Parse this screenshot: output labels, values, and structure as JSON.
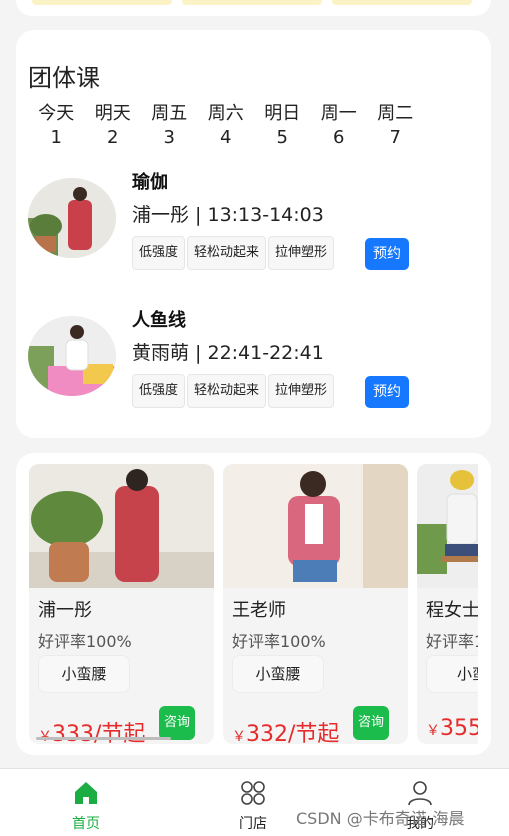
{
  "group_classes": {
    "title": "团体课",
    "days": [
      {
        "label": "今天",
        "num": "1"
      },
      {
        "label": "明天",
        "num": "2"
      },
      {
        "label": "周五",
        "num": "3"
      },
      {
        "label": "周六",
        "num": "4"
      },
      {
        "label": "明日",
        "num": "5"
      },
      {
        "label": "周一",
        "num": "6"
      },
      {
        "label": "周二",
        "num": "7"
      }
    ],
    "classes": [
      {
        "name": "瑜伽",
        "info": "浦一彤 | 13:13-14:03",
        "tags": [
          "低强度",
          "轻松动起来",
          "拉伸塑形"
        ],
        "button": "预约"
      },
      {
        "name": "人鱼线",
        "info": "黄雨萌 | 22:41-22:41",
        "tags": [
          "低强度",
          "轻松动起来",
          "拉伸塑形"
        ],
        "button": "预约"
      }
    ]
  },
  "coaches": [
    {
      "name": "浦一彤",
      "rating": "好评率100%",
      "tag": "小蛮腰",
      "currency": "￥",
      "price": "333/节起",
      "button": "咨询"
    },
    {
      "name": "王老师",
      "rating": "好评率100%",
      "tag": "小蛮腰",
      "currency": "￥",
      "price": "332/节起",
      "button": "咨询"
    },
    {
      "name": "程女士",
      "rating": "好评率1",
      "tag": "小蛮",
      "currency": "￥",
      "price": "355",
      "button": ""
    }
  ],
  "bottom_nav": [
    {
      "label": "首页",
      "icon": "home-icon",
      "active": true
    },
    {
      "label": "门店",
      "icon": "grid-icon",
      "active": false
    },
    {
      "label": "我的",
      "icon": "user-icon",
      "active": false
    }
  ],
  "watermark": "CSDN @卡布奇诺-海晨",
  "colors": {
    "accent_blue": "#1677ff",
    "accent_green": "#1bbc4b",
    "nav_active": "#1aad43",
    "price_red": "#e52b2b"
  }
}
